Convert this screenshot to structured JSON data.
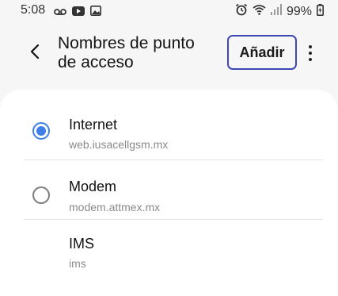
{
  "status_bar": {
    "time": "5:08",
    "left_icons": [
      "voicemail-icon",
      "youtube-icon",
      "gallery-icon"
    ],
    "right_icons": [
      "alarm-icon",
      "wifi-icon",
      "signal-icon"
    ],
    "battery": "99%"
  },
  "header": {
    "title": "Nombres de punto de acceso",
    "add_label": "Añadir",
    "accent_color": "#3e48b2"
  },
  "apn_list": [
    {
      "name": "Internet",
      "apn": "web.iusacellgsm.mx",
      "selected": true,
      "has_radio": true
    },
    {
      "name": "Modem",
      "apn": "modem.attmex.mx",
      "selected": false,
      "has_radio": true
    },
    {
      "name": "IMS",
      "apn": "ims",
      "selected": false,
      "has_radio": false
    }
  ],
  "radio_selected_color": "#3e7fe8"
}
